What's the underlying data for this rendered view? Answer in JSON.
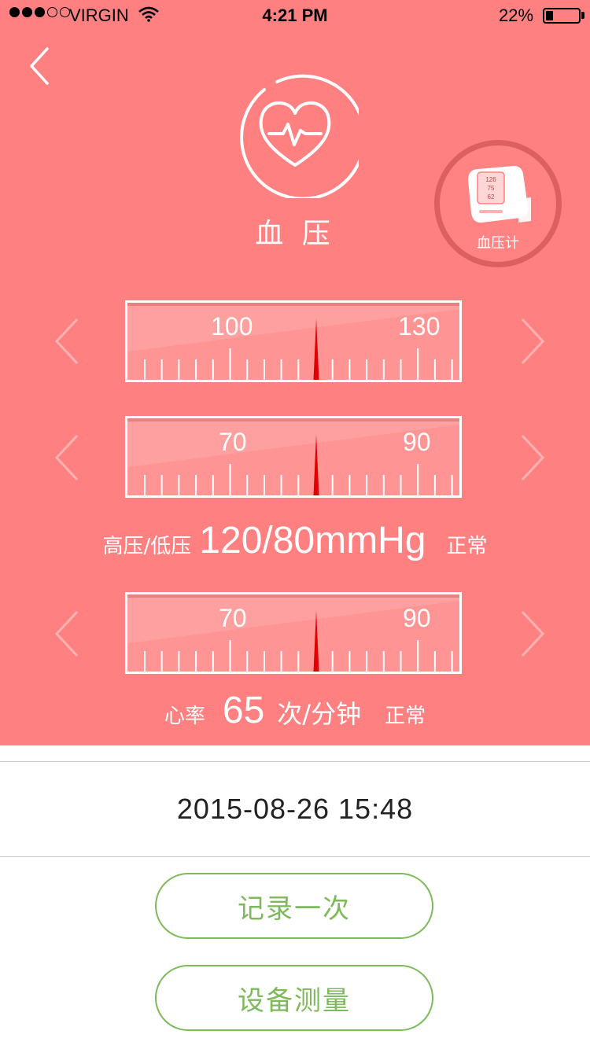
{
  "status_bar": {
    "carrier": "VIRGIN",
    "time": "4:21 PM",
    "battery": "22%",
    "battery_level": 0.22
  },
  "header": {
    "title": "血 压",
    "icon": "heart-pulse-icon"
  },
  "device": {
    "label": "血压计",
    "icon": "blood-pressure-monitor-icon",
    "screen_values": [
      "126",
      "75",
      "62"
    ]
  },
  "gauges": [
    {
      "left_label": "100",
      "right_label": "130"
    },
    {
      "left_label": "70",
      "right_label": "90"
    },
    {
      "left_label": "70",
      "right_label": "90"
    }
  ],
  "blood_pressure": {
    "label": "高压/低压",
    "value": "120/80mmHg",
    "status": "正常"
  },
  "heart_rate": {
    "label": "心率",
    "value": "65",
    "unit": "次/分钟",
    "status": "正常"
  },
  "timestamp": "2015-08-26  15:48",
  "buttons": {
    "record": "记录一次",
    "measure": "设备测量"
  },
  "colors": {
    "header_bg": "#ff8080",
    "needle": "#e00000",
    "button_green": "#7dba5b"
  }
}
